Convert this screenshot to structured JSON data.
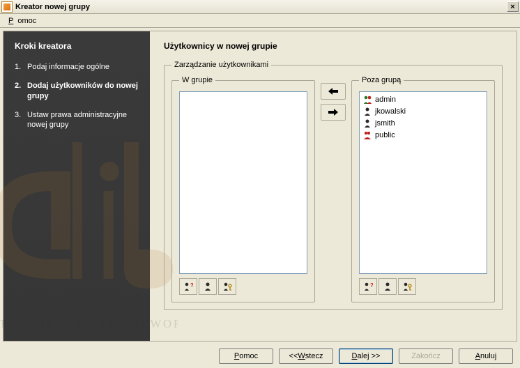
{
  "window": {
    "title": "Kreator nowej grupy",
    "close_glyph": "×"
  },
  "menu": {
    "help": "Pomoc",
    "help_underline_index": 0
  },
  "sidebar": {
    "heading": "Kroki kreatora",
    "steps": [
      {
        "num": "1.",
        "label": "Podaj informacje ogólne"
      },
      {
        "num": "2.",
        "label": "Dodaj użytkowników do nowej grupy"
      },
      {
        "num": "3.",
        "label": "Ustaw prawa administracyjne nowej grupy"
      }
    ],
    "current_step_index": 1
  },
  "main": {
    "title": "Użytkownicy w nowej grupie",
    "outer_legend": "Zarządzanie użytkownikami",
    "left_legend": "W grupie",
    "right_legend": "Poza grupą",
    "in_group": [],
    "out_group": [
      {
        "name": "admin",
        "icon": "user-admin-icon"
      },
      {
        "name": "jkowalski",
        "icon": "user-person-icon"
      },
      {
        "name": "jsmith",
        "icon": "user-person-icon"
      },
      {
        "name": "public",
        "icon": "user-group-icon"
      }
    ],
    "toolbar_icons": [
      "user-qmark-icon",
      "user-person-icon",
      "user-key-icon"
    ]
  },
  "buttons": {
    "move_left_title": "Przenieś w lewo",
    "move_right_title": "Przenieś w prawo"
  },
  "footer": {
    "help": "Pomoc",
    "back": "<< Wstecz",
    "next": "Dalej >>",
    "finish": "Zakończ",
    "cancel": "Anuluj"
  }
}
